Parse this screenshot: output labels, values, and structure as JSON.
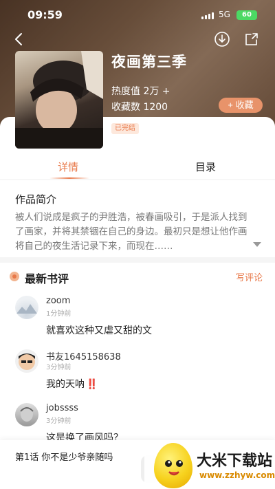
{
  "status": {
    "time": "09:59",
    "network": "5G",
    "battery": "60"
  },
  "book": {
    "title": "夜画第三季",
    "heat": "热度值 2万 +",
    "favorites": "收藏数 1200",
    "fav_button": "+ 收藏",
    "status_badge": "已完结"
  },
  "tabs": [
    {
      "label": "详情"
    },
    {
      "label": "目录"
    }
  ],
  "intro": {
    "heading": "作品简介",
    "text": "被人们说成是疯子的尹胜浩，被春画吸引，于是派人找到了画家，并将其禁锢在自己的身边。最初只是想让他作画将自己的夜生活记录下来，而现在……"
  },
  "reviews": {
    "heading": "最新书评",
    "write_label": "写评论",
    "items": [
      {
        "name": "zoom",
        "time": "1分钟前",
        "content": "就喜欢这种又虐又甜的文",
        "emoji": ""
      },
      {
        "name": "书友1645158638",
        "time": "3分钟前",
        "content": "我的天呐",
        "emoji": "‼️"
      },
      {
        "name": "jobssss",
        "time": "3分钟前",
        "content": "这是换了画风吗？",
        "emoji": ""
      }
    ]
  },
  "bottom": {
    "chapter": "第1话 你不是少爷亲随吗"
  },
  "watermark": {
    "title": "大米下载站",
    "url": "www.zzhyw.com"
  },
  "colors": {
    "accent": "#e8794a",
    "badge_bg": "#fde8dc",
    "battery": "#4cd964"
  }
}
